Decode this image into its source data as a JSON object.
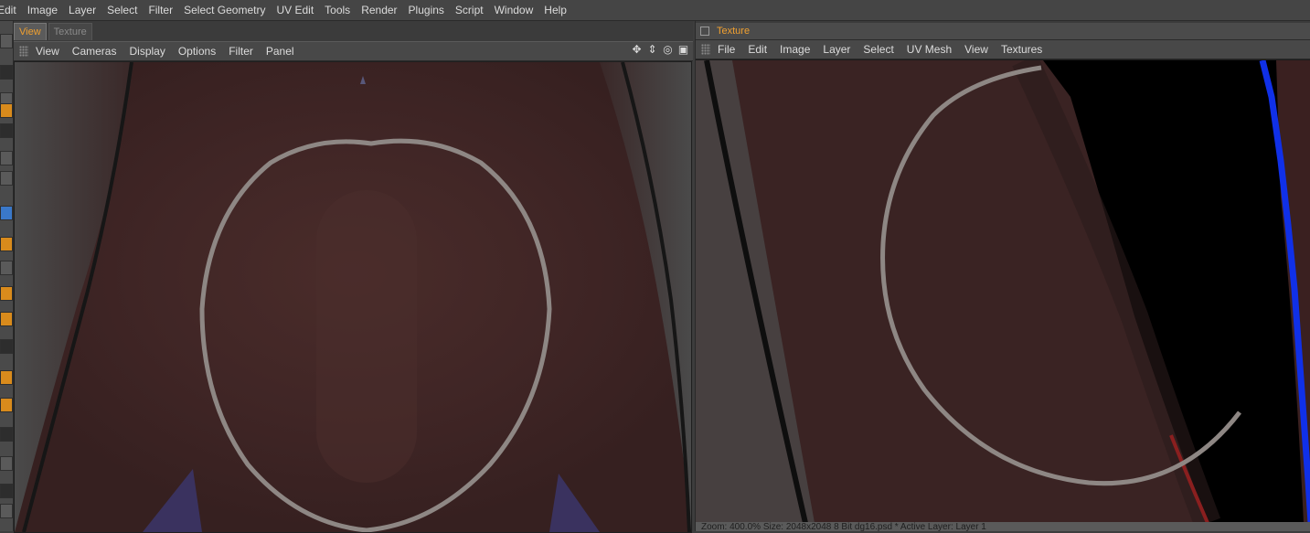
{
  "menubar": {
    "items": [
      "Edit",
      "Image",
      "Layer",
      "Select",
      "Filter",
      "Select Geometry",
      "UV Edit",
      "Tools",
      "Render",
      "Plugins",
      "Script",
      "Window",
      "Help"
    ]
  },
  "left_panel": {
    "tabs": [
      {
        "label": "View",
        "active": true
      },
      {
        "label": "Texture",
        "active": false
      }
    ],
    "menu": [
      "View",
      "Cameras",
      "Display",
      "Options",
      "Filter",
      "Panel"
    ],
    "controls": [
      {
        "name": "move-view-icon",
        "glyph": "✥"
      },
      {
        "name": "dolly-view-icon",
        "glyph": "⇕"
      },
      {
        "name": "rotate-view-icon",
        "glyph": "◎"
      },
      {
        "name": "maximize-view-icon",
        "glyph": "▣"
      }
    ]
  },
  "right_panel": {
    "title": "Texture",
    "menu": [
      "File",
      "Edit",
      "Image",
      "Layer",
      "Select",
      "UV Mesh",
      "View",
      "Textures"
    ],
    "status": "Zoom: 400.0%  Size: 2048x2048  8 Bit  dg16.psd *  Active Layer: Layer 1"
  },
  "colors": {
    "accent": "#f0a030",
    "skin": "#3f2525",
    "stroke": "#8e8784",
    "uv_edge": "#1030e8"
  }
}
